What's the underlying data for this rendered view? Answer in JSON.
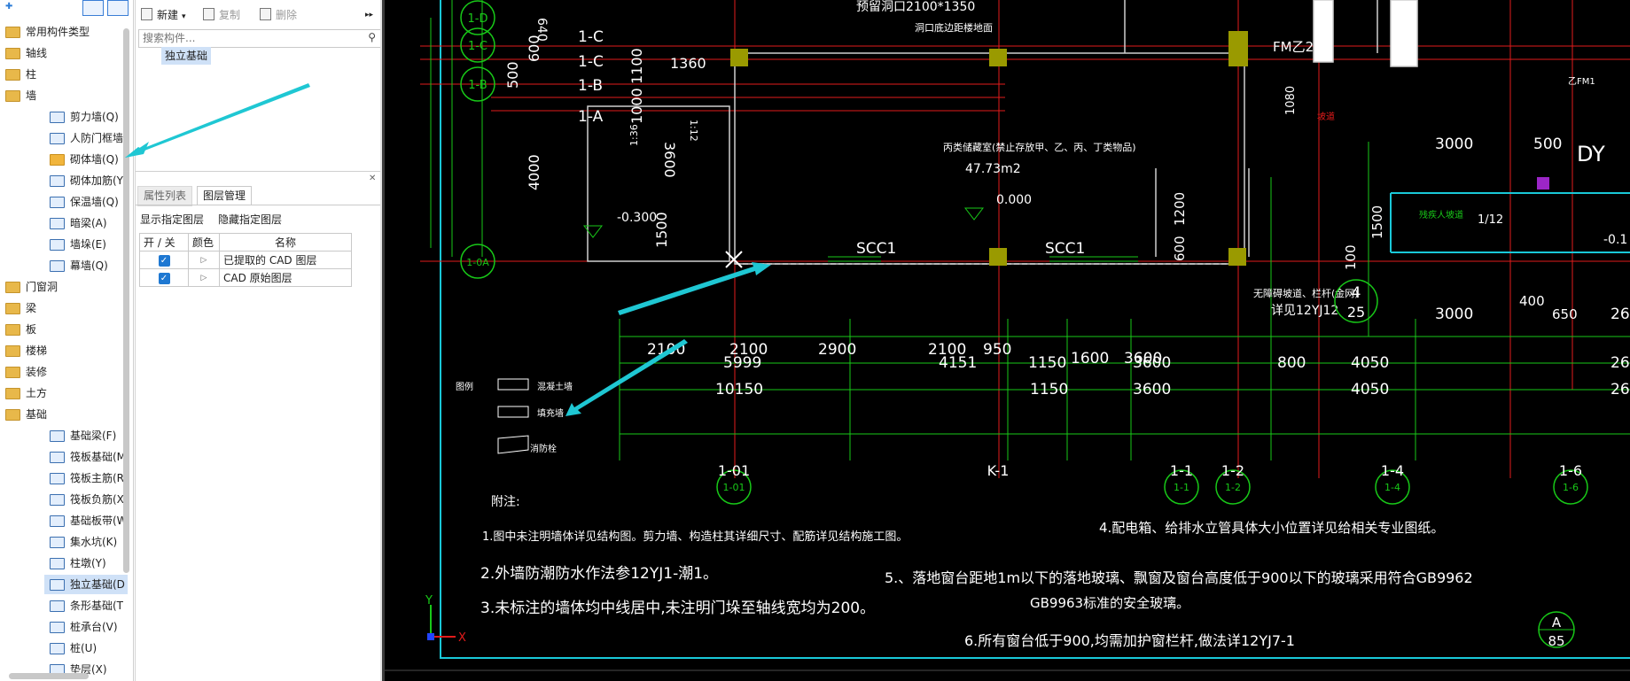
{
  "tree": {
    "categories": [
      {
        "label": "常用构件类型"
      },
      {
        "label": "轴线"
      },
      {
        "label": "柱"
      },
      {
        "label": "墙"
      },
      {
        "label": "门窗洞"
      },
      {
        "label": "梁"
      },
      {
        "label": "板"
      },
      {
        "label": "楼梯"
      },
      {
        "label": "装修"
      },
      {
        "label": "土方"
      },
      {
        "label": "基础"
      }
    ],
    "wall_items": [
      {
        "label": "剪力墙(Q)"
      },
      {
        "label": "人防门框墙"
      },
      {
        "label": "砌体墙(Q)"
      },
      {
        "label": "砌体加筋(Y"
      },
      {
        "label": "保温墙(Q)"
      },
      {
        "label": "暗梁(A)"
      },
      {
        "label": "墙垛(E)"
      },
      {
        "label": "幕墙(Q)"
      }
    ],
    "foundation_items": [
      {
        "label": "基础梁(F)"
      },
      {
        "label": "筏板基础(M"
      },
      {
        "label": "筏板主筋(R"
      },
      {
        "label": "筏板负筋(X"
      },
      {
        "label": "基础板带(W"
      },
      {
        "label": "集水坑(K)"
      },
      {
        "label": "柱墩(Y)"
      },
      {
        "label": "独立基础(D"
      },
      {
        "label": "条形基础(T"
      },
      {
        "label": "桩承台(V)"
      },
      {
        "label": "桩(U)"
      },
      {
        "label": "垫层(X)"
      }
    ]
  },
  "toolbar": {
    "new_label": "新建",
    "copy_label": "复制",
    "delete_label": "删除",
    "more_glyph": "▸▸"
  },
  "component_list": {
    "search_placeholder": "搜索构件...",
    "items": [
      {
        "label": "独立基础"
      }
    ]
  },
  "props_panel": {
    "tabs": [
      {
        "label": "属性列表"
      },
      {
        "label": "图层管理"
      }
    ],
    "show_layer": "显示指定图层",
    "hide_layer": "隐藏指定图层",
    "columns": [
      "开 / 关",
      "颜色",
      "名称"
    ],
    "rows": [
      {
        "name": "已提取的 CAD 图层",
        "checked": true
      },
      {
        "name": "CAD 原始图层",
        "checked": true
      }
    ]
  },
  "cad": {
    "axis_left": [
      "1-D",
      "1-C",
      "1-B",
      "1-A",
      "1-0A"
    ],
    "axis_labels_left_side": [
      "1-C",
      "1-C",
      "1-B",
      "1-A"
    ],
    "axis_bottom": [
      "1-01",
      "K-1",
      "1-1",
      "1-2",
      "1-4",
      "1-6"
    ],
    "top_note_1": "预留洞口2100*1350",
    "top_note_2": "洞口底边距楼地面",
    "fm_label": "FM乙2",
    "room_desc": "丙类储藏室(禁止存放甲、乙、丙、丁类物品)",
    "room_area": "47.73m2",
    "level_0000": "0.000",
    "level_m0300": "-0.300",
    "level_m01": "-0.1",
    "scc1": "SCC1",
    "dy": "DY",
    "fm1": "乙FM1",
    "dim_left": [
      "600",
      "500",
      "4000",
      "1100",
      "1000",
      "1360",
      "3600",
      "1:12",
      "1500",
      "1:36",
      "640"
    ],
    "dim_right_vert": [
      "1200",
      "600",
      "1500",
      "100",
      "1080"
    ],
    "dim_top_right": [
      "3000",
      "500",
      "1/12",
      "3000",
      "400",
      "650",
      "26"
    ],
    "dim_row1": [
      "2100",
      "2100",
      "2900",
      "2100",
      "950",
      "1600",
      "3600",
      "800",
      "4050",
      "26"
    ],
    "dim_row1_big": [
      "5999",
      "4151",
      "1150",
      "3600"
    ],
    "dim_row2": [
      "10150",
      "1150",
      "3600",
      "4050",
      "26"
    ],
    "stair_note_1": "无障碍坡道、栏杆(金网)",
    "stair_note_2": "详见12YJ12",
    "detail_num": "4",
    "detail_page": "25",
    "barrier_note": "残疾人坡道",
    "slope_note": "坡道",
    "legend_title": "图例",
    "legend_items": [
      "混凝土墙",
      "填充墙",
      "消防栓"
    ],
    "notes_title": "附注:",
    "notes": [
      "1.图中未注明墙体详见结构图。剪力墙、构造柱其详细尺寸、配筋详见结构施工图。",
      "2.外墙防潮防水作法参12YJ1-潮1。",
      "3.未标注的墙体均中线居中,未注明门垛至轴线宽均为200。",
      "4.配电箱、给排水立管具体大小位置详见给相关专业图纸。",
      "5.、落地窗台距地1m以下的落地玻璃、飘窗及窗台高度低于900以下的玻璃采用符合GB9962",
      "GB9963标准的安全玻璃。",
      "6.所有窗台低于900,均需加护窗栏杆,做法详12YJ7-1"
    ],
    "sheet_label": "A",
    "sheet_num": "85",
    "ucs_x": "X",
    "ucs_y": "Y"
  },
  "colors": {
    "cad_bg": "#000000",
    "axis_line": "#e21b1b",
    "dim_line": "#18c818",
    "wall": "#cfcfcf",
    "column": "#9a9a00",
    "arrow": "#1fc7d3",
    "frame": "#19c8d8"
  }
}
